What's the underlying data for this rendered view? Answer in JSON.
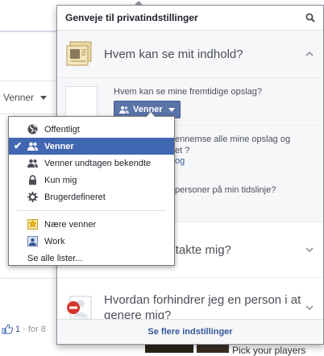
{
  "background": {
    "audience_label": "Venner",
    "like_count": "1",
    "like_suffix": "· for 8",
    "promo_text": "Pick your players"
  },
  "flyout": {
    "title": "Genveje til privatindstillinger",
    "footer_link": "Se flere indstillinger",
    "sections": [
      {
        "title": "Hvem kan se mit indhold?",
        "state": "expanded",
        "items": [
          {
            "question": "Hvem kan se mine fremtidige opslag?",
            "button_label": "Venner"
          },
          {
            "question_part": "ennemse alle mine opslag og",
            "question_part2": "et ?",
            "link": "og"
          },
          {
            "question_part": "personer på min tidslinje?"
          }
        ]
      },
      {
        "title": "ontakte mig?",
        "state": "collapsed"
      },
      {
        "title": "Hvordan forhindrer jeg en person i at genere mig?",
        "state": "collapsed"
      }
    ]
  },
  "audience_menu": {
    "options": [
      {
        "label": "Offentligt",
        "icon": "globe-icon",
        "selected": false
      },
      {
        "label": "Venner",
        "icon": "friends-icon",
        "selected": true
      },
      {
        "label": "Venner undtagen bekendte",
        "icon": "friends-except-icon",
        "selected": false
      },
      {
        "label": "Kun mig",
        "icon": "lock-icon",
        "selected": false
      },
      {
        "label": "Brugerdefineret",
        "icon": "gear-icon",
        "selected": false
      }
    ],
    "lists": [
      {
        "label": "Nære venner",
        "icon": "star-icon"
      },
      {
        "label": "Work",
        "icon": "work-icon"
      }
    ],
    "see_all": "Se alle lister...",
    "checkmark": "✔"
  }
}
